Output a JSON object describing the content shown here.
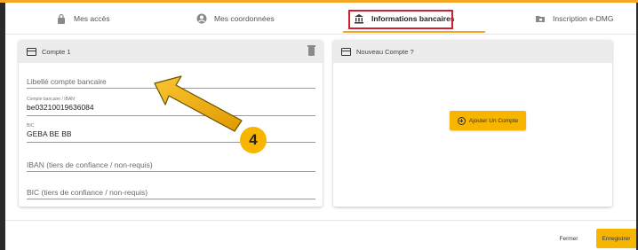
{
  "tabs": [
    {
      "label": "Mes accès",
      "icon": "lock-icon"
    },
    {
      "label": "Mes coordonnées",
      "icon": "user-circle-icon"
    },
    {
      "label": "Informations bancaires",
      "icon": "bank-icon",
      "active": true
    },
    {
      "label": "Inscription e-DMG",
      "icon": "folder-icon"
    }
  ],
  "card1": {
    "title": "Compte 1",
    "fields": {
      "libelle": {
        "placeholder": "Libellé compte bancaire"
      },
      "iban": {
        "label": "Compte bancaire / IBAN",
        "value": "be03210019636084"
      },
      "bic": {
        "label": "BIC",
        "value": "GEBA BE BB"
      },
      "iban_tiers": {
        "placeholder": "IBAN (tiers de confiance / non-requis)"
      },
      "bic_tiers": {
        "placeholder": "BIC (tiers de confiance / non-requis)"
      }
    }
  },
  "card2": {
    "title": "Nouveau Compte ?",
    "add_button": "Ajouter Un Compte"
  },
  "footer": {
    "close": "Fermer",
    "save": "Enregistrer"
  },
  "annotation": {
    "step": "4"
  },
  "colors": {
    "accent": "#f7b500",
    "highlight": "#d0202f"
  }
}
